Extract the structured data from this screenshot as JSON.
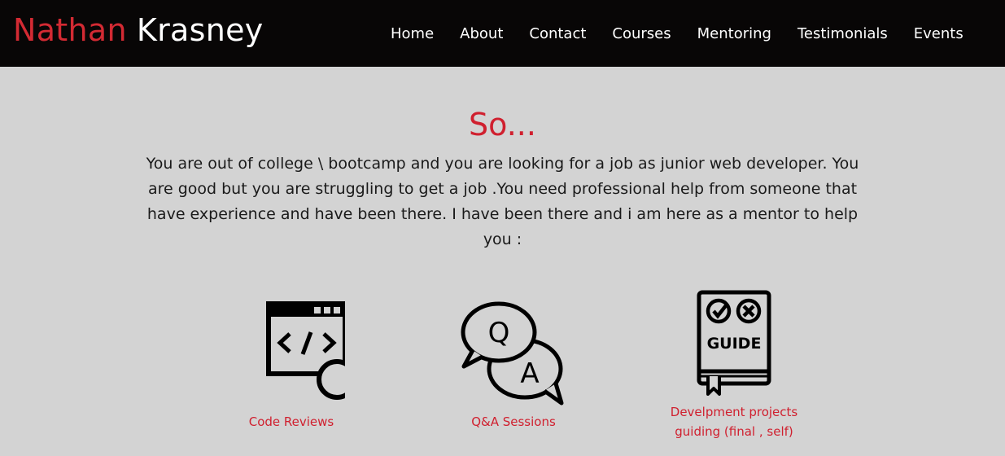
{
  "header": {
    "brand_first": "Nathan",
    "brand_last": "Krasney",
    "nav": [
      "Home",
      "About",
      "Contact",
      "Courses",
      "Mentoring",
      "Testimonials",
      "Events"
    ]
  },
  "intro": {
    "title": "So...",
    "text": "You are out of college \\ bootcamp and you are looking for a job as junior web developer. You are good but you are struggling to get a job .You need professional help from someone that have experience and have been there. I have been there and i am here as a mentor to help you :"
  },
  "services": [
    {
      "label": "Code Reviews",
      "icon": "code-review-icon"
    },
    {
      "label": "Q&A Sessions",
      "icon": "qa-bubbles-icon"
    },
    {
      "label": "Develpment projects guiding (final , self)",
      "icon": "guide-book-icon",
      "icon_text": "GUIDE"
    }
  ],
  "colors": {
    "accent": "#d0202f",
    "header_bg": "#080606",
    "page_bg": "#d3d3d3"
  }
}
